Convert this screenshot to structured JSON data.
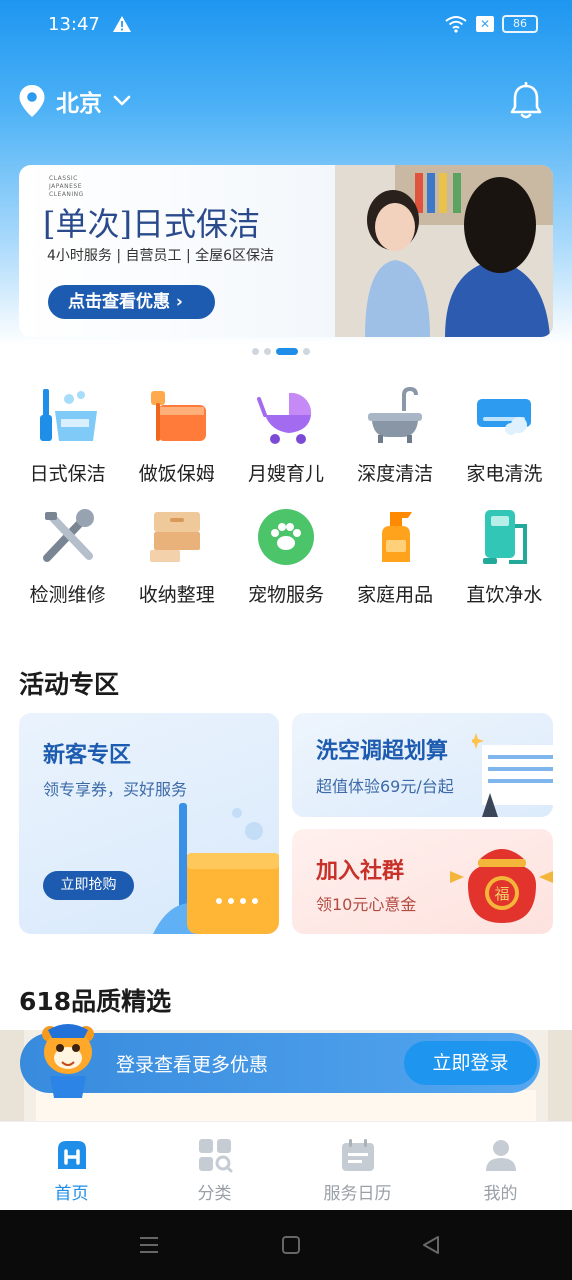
{
  "status_bar": {
    "time": "13:47",
    "battery": "86"
  },
  "location": {
    "city": "北京"
  },
  "banner": {
    "small_text": "CLASSIC\nJAPANESE\nCLEANING",
    "title": "[单次]日式保洁",
    "subtitle": "4小时服务 | 自营员工 | 全屋6区保洁",
    "button": "点击查看优惠 ›",
    "pager": {
      "count": 4,
      "active": 2
    }
  },
  "services": [
    {
      "label": "日式保洁",
      "icon": "mop-bucket-icon"
    },
    {
      "label": "做饭保姆",
      "icon": "cooking-pot-icon"
    },
    {
      "label": "月嫂育儿",
      "icon": "baby-stroller-icon"
    },
    {
      "label": "深度清洁",
      "icon": "bathtub-icon"
    },
    {
      "label": "家电清洗",
      "icon": "air-conditioner-icon"
    },
    {
      "label": "检测维修",
      "icon": "repair-tools-icon"
    },
    {
      "label": "收纳整理",
      "icon": "storage-box-icon"
    },
    {
      "label": "宠物服务",
      "icon": "paw-icon"
    },
    {
      "label": "家庭用品",
      "icon": "spray-bottle-icon"
    },
    {
      "label": "直饮净水",
      "icon": "water-purifier-icon"
    }
  ],
  "activity": {
    "title": "活动专区",
    "new_customer": {
      "title": "新客专区",
      "subtitle": "领专享券，买好服务",
      "button": "立即抢购"
    },
    "ac_wash": {
      "title": "洗空调超划算",
      "subtitle": "超值体验69元/台起"
    },
    "community": {
      "title": "加入社群",
      "subtitle": "领10元心意金"
    }
  },
  "quality": {
    "title": "618品质精选"
  },
  "login_prompt": {
    "text": "登录查看更多优惠",
    "button": "立即登录"
  },
  "tabbar": [
    {
      "label": "首页",
      "icon": "home-icon",
      "active": true
    },
    {
      "label": "分类",
      "icon": "category-icon",
      "active": false
    },
    {
      "label": "服务日历",
      "icon": "calendar-icon",
      "active": false
    },
    {
      "label": "我的",
      "icon": "profile-icon",
      "active": false
    }
  ],
  "colors": {
    "brand_blue": "#1e8ee8",
    "dark_blue": "#1c5bb0",
    "promo_red": "#c8312a"
  }
}
